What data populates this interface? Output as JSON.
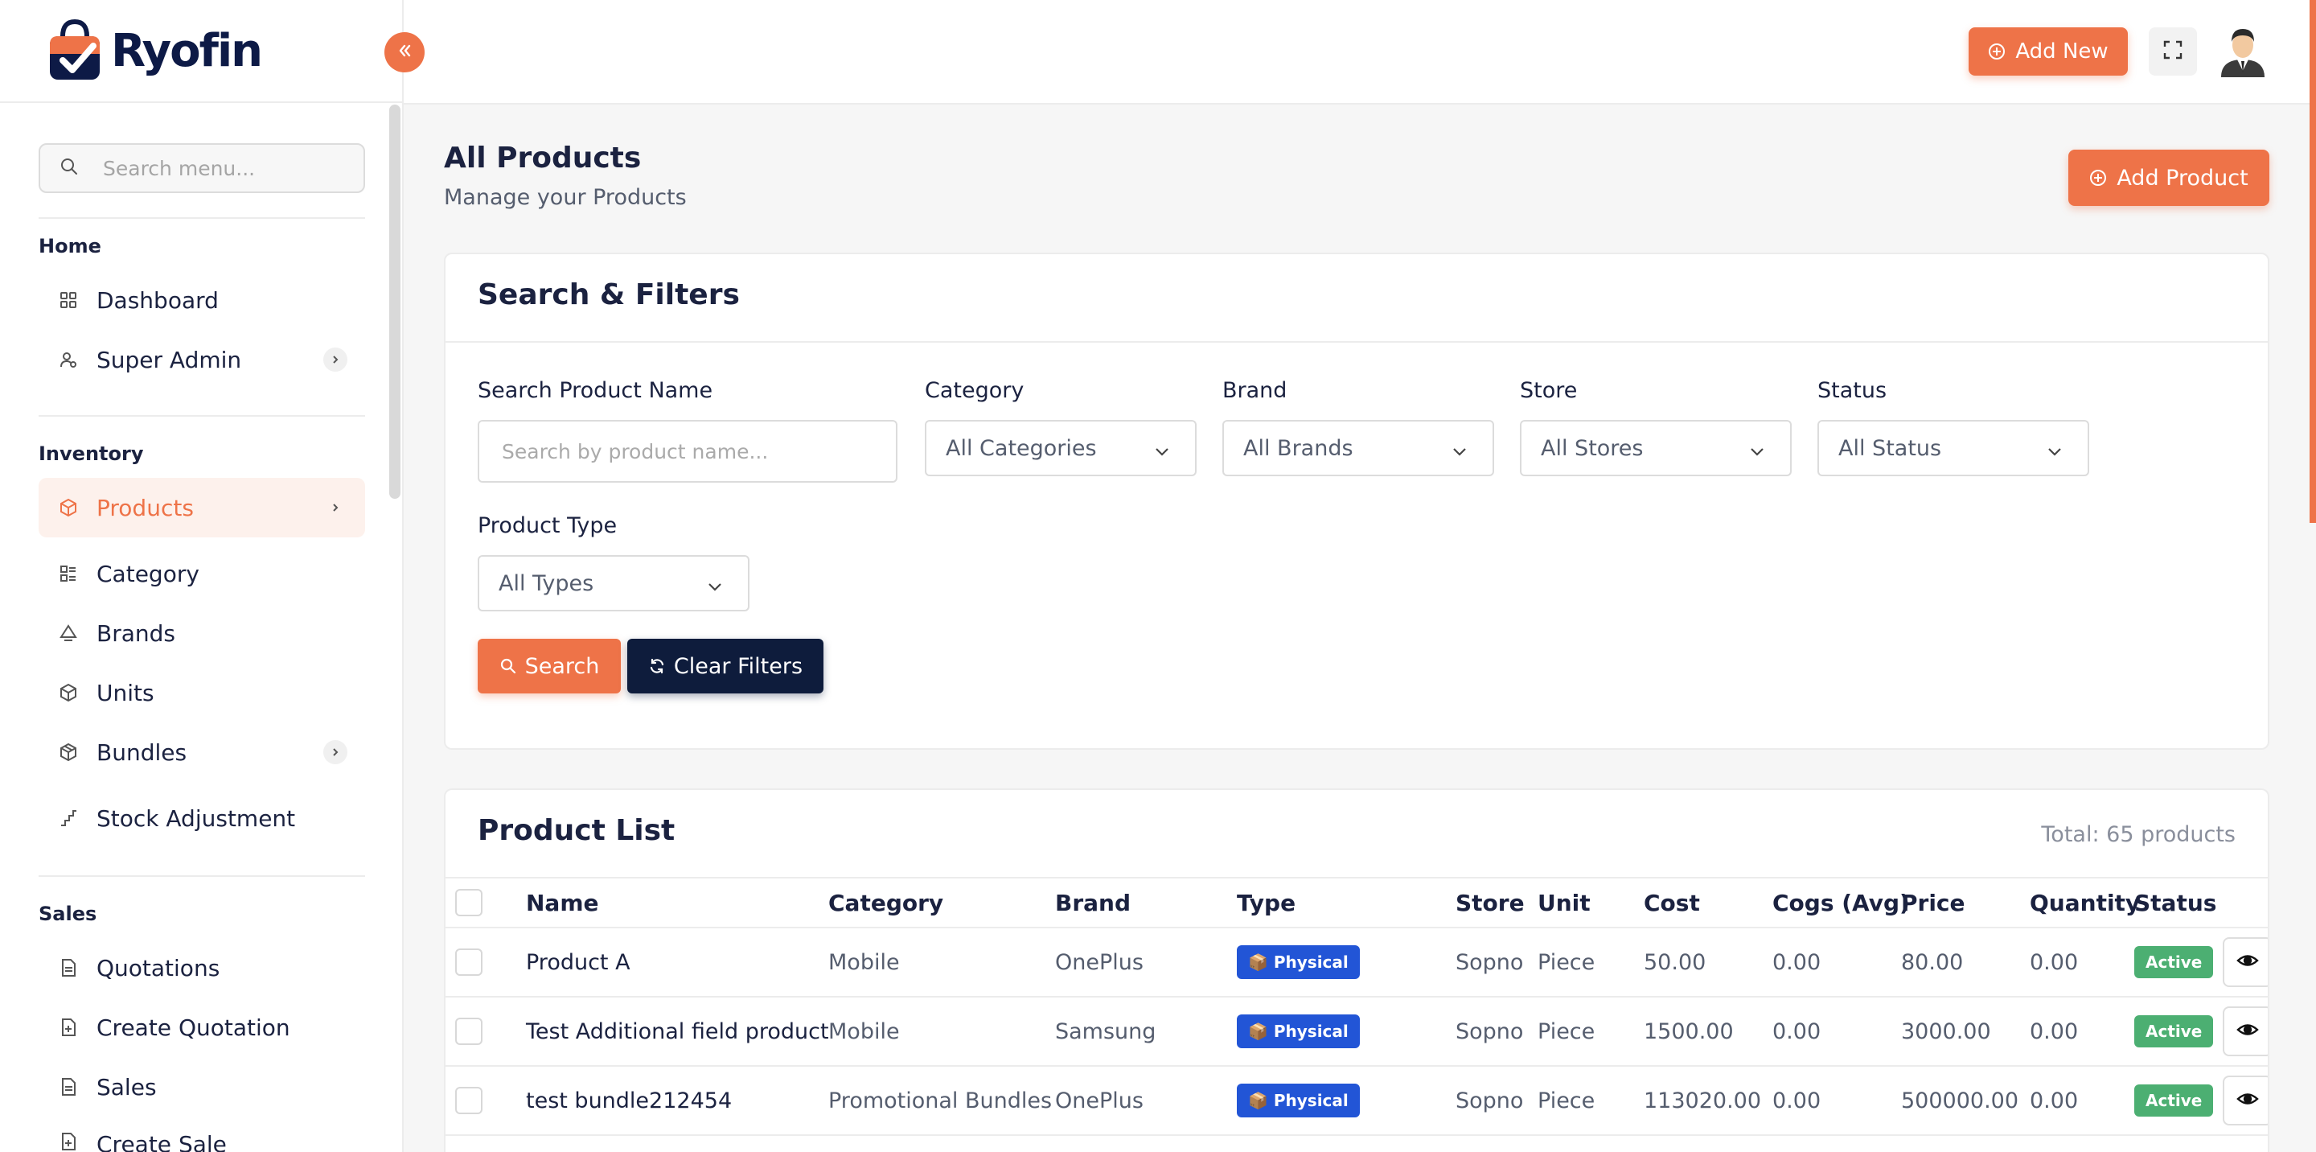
{
  "app": {
    "name": "Ryofin"
  },
  "sidebar": {
    "search_placeholder": "Search menu...",
    "sections": {
      "home": "Home",
      "inventory": "Inventory",
      "sales": "Sales"
    },
    "items": {
      "dashboard": "Dashboard",
      "super_admin": "Super Admin",
      "products": "Products",
      "category": "Category",
      "brands": "Brands",
      "units": "Units",
      "bundles": "Bundles",
      "stock_adjustment": "Stock Adjustment",
      "quotations": "Quotations",
      "create_quotation": "Create Quotation",
      "sales": "Sales",
      "create_sale": "Create Sale"
    }
  },
  "header": {
    "add_new": "Add New"
  },
  "page": {
    "title": "All Products",
    "subtitle": "Manage your Products",
    "add_product": "Add Product"
  },
  "filters": {
    "title": "Search & Filters",
    "search_label": "Search Product Name",
    "search_placeholder": "Search by product name...",
    "category_label": "Category",
    "category_value": "All Categories",
    "brand_label": "Brand",
    "brand_value": "All Brands",
    "store_label": "Store",
    "store_value": "All Stores",
    "status_label": "Status",
    "status_value": "All Status",
    "type_label": "Product Type",
    "type_value": "All Types",
    "search_button": "Search",
    "clear_button": "Clear Filters"
  },
  "product_list": {
    "title": "Product List",
    "total": "Total: 65 products",
    "columns": {
      "name": "Name",
      "category": "Category",
      "brand": "Brand",
      "type": "Type",
      "store": "Store",
      "unit": "Unit",
      "cost": "Cost",
      "cogs": "Cogs (Avg)",
      "price": "Price",
      "quantity": "Quantity",
      "status": "Status"
    },
    "rows": [
      {
        "name": "Product A",
        "category": "Mobile",
        "brand": "OnePlus",
        "type": "📦 Physical",
        "store": "Sopno",
        "unit": "Piece",
        "cost": "50.00",
        "cogs": "0.00",
        "price": "80.00",
        "quantity": "0.00",
        "status": "Active"
      },
      {
        "name": "Test Additional field product",
        "category": "Mobile",
        "brand": "Samsung",
        "type": "📦 Physical",
        "store": "Sopno",
        "unit": "Piece",
        "cost": "1500.00",
        "cogs": "0.00",
        "price": "3000.00",
        "quantity": "0.00",
        "status": "Active"
      },
      {
        "name": "test bundle212454",
        "category": "Promotional Bundles",
        "brand": "OnePlus",
        "type": "📦 Physical",
        "store": "Sopno",
        "unit": "Piece",
        "cost": "113020.00",
        "cogs": "0.00",
        "price": "500000.00",
        "quantity": "0.00",
        "status": "Active"
      }
    ]
  },
  "colors": {
    "accent": "#ee7348",
    "navy": "#0e1c3c",
    "type_badge": "#2255d6",
    "status_badge": "#4caf72"
  }
}
